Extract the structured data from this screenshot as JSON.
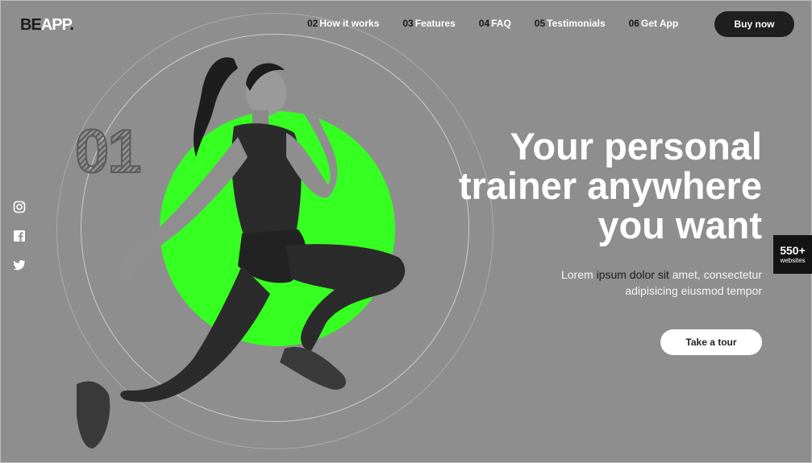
{
  "brand": {
    "be": "BE",
    "app": "APP",
    "dot": "."
  },
  "nav": [
    {
      "num": "02",
      "label": "How it works"
    },
    {
      "num": "03",
      "label": "Features"
    },
    {
      "num": "04",
      "label": "FAQ"
    },
    {
      "num": "05",
      "label": "Testimonials"
    },
    {
      "num": "06",
      "label": "Get App"
    }
  ],
  "buy_label": "Buy now",
  "slide_number": "01",
  "headline": {
    "line1": "Your personal",
    "line2": "trainer anywhere",
    "line3": "you want"
  },
  "lede": {
    "p1": "Lorem ",
    "p2": "ipsum dolor sit",
    "p3": " amet, consectetur",
    "line2": "adipisicing eiusmod tempor"
  },
  "tour_label": "Take a tour",
  "badge": {
    "count": "550+",
    "label": "websites"
  },
  "social": [
    "instagram-icon",
    "facebook-icon",
    "twitter-icon"
  ],
  "colors": {
    "accent": "#36ff22",
    "background": "#8e8e8e",
    "dark": "#1f1f1f"
  }
}
